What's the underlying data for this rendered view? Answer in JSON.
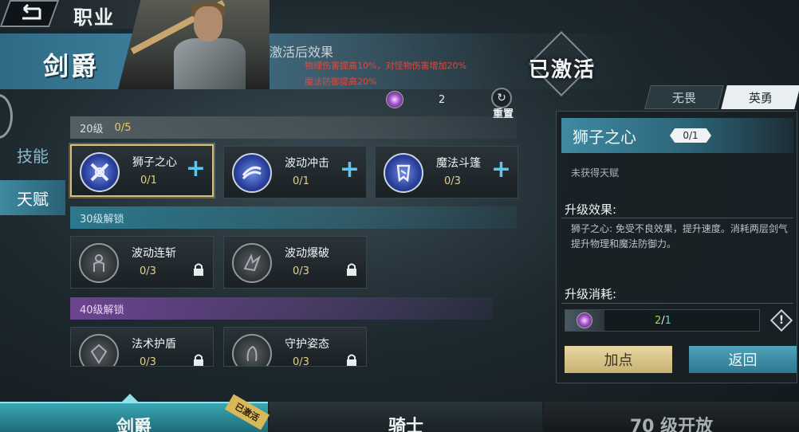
{
  "header": {
    "back_icon": "back-arrow-icon",
    "title": "职业"
  },
  "banner": {
    "class_name": "剑爵",
    "effect_title": "激活后效果",
    "effect_lines": [
      "物理伤害提高10%，对怪物伤害增加20%",
      "魔法防御提高20%"
    ],
    "status": "已激活"
  },
  "points": {
    "icon": "talent-gem-icon",
    "value": "2",
    "reset_label": "重置"
  },
  "side_tabs": [
    {
      "label": "技能",
      "active": false
    },
    {
      "label": "天赋",
      "active": true
    }
  ],
  "tiers": [
    {
      "label": "20级",
      "progress": "0/5",
      "nodes": [
        {
          "name": "狮子之心",
          "count": "0/1",
          "icon": "lion-heart-icon",
          "locked": false,
          "selected": true
        },
        {
          "name": "波动冲击",
          "count": "0/1",
          "icon": "wave-strike-icon",
          "locked": false,
          "selected": false
        },
        {
          "name": "魔法斗篷",
          "count": "0/3",
          "icon": "magic-cloak-icon",
          "locked": false,
          "selected": false
        }
      ]
    },
    {
      "label": "30级解锁",
      "nodes": [
        {
          "name": "波动连斩",
          "count": "0/3",
          "icon": "wave-combo-icon",
          "locked": true
        },
        {
          "name": "波动爆破",
          "count": "0/3",
          "icon": "wave-burst-icon",
          "locked": true
        }
      ]
    },
    {
      "label": "40级解锁",
      "nodes": [
        {
          "name": "法术护盾",
          "count": "0/3",
          "icon": "spell-shield-icon",
          "locked": true
        },
        {
          "name": "守护姿态",
          "count": "0/3",
          "icon": "guard-stance-icon",
          "locked": true
        }
      ]
    }
  ],
  "mode_tabs": [
    {
      "label": "无畏",
      "active": false
    },
    {
      "label": "英勇",
      "active": true
    }
  ],
  "detail": {
    "name": "狮子之心",
    "level": "0/1",
    "status": "未获得天赋",
    "effect_title": "升级效果:",
    "effect_desc": "狮子之心: 免受不良效果，提升速度。消耗两层剑气提升物理和魔法防御力。",
    "cost_title": "升级消耗:",
    "cost_have": "2",
    "cost_sep": "/",
    "cost_need": "1",
    "cost_fraction": 0.2,
    "add_label": "加点",
    "back_label": "返回"
  },
  "bottom_nav": [
    {
      "label": "剑爵",
      "active": true,
      "ribbon": "已激活"
    },
    {
      "label": "骑士",
      "active": false
    },
    {
      "label": "70 级开放",
      "active": false
    }
  ],
  "colors": {
    "accent": "#3e8aa1",
    "gold": "#d6c07a",
    "effect_red": "#e2483c",
    "plus_blue": "#5ec7ef"
  }
}
